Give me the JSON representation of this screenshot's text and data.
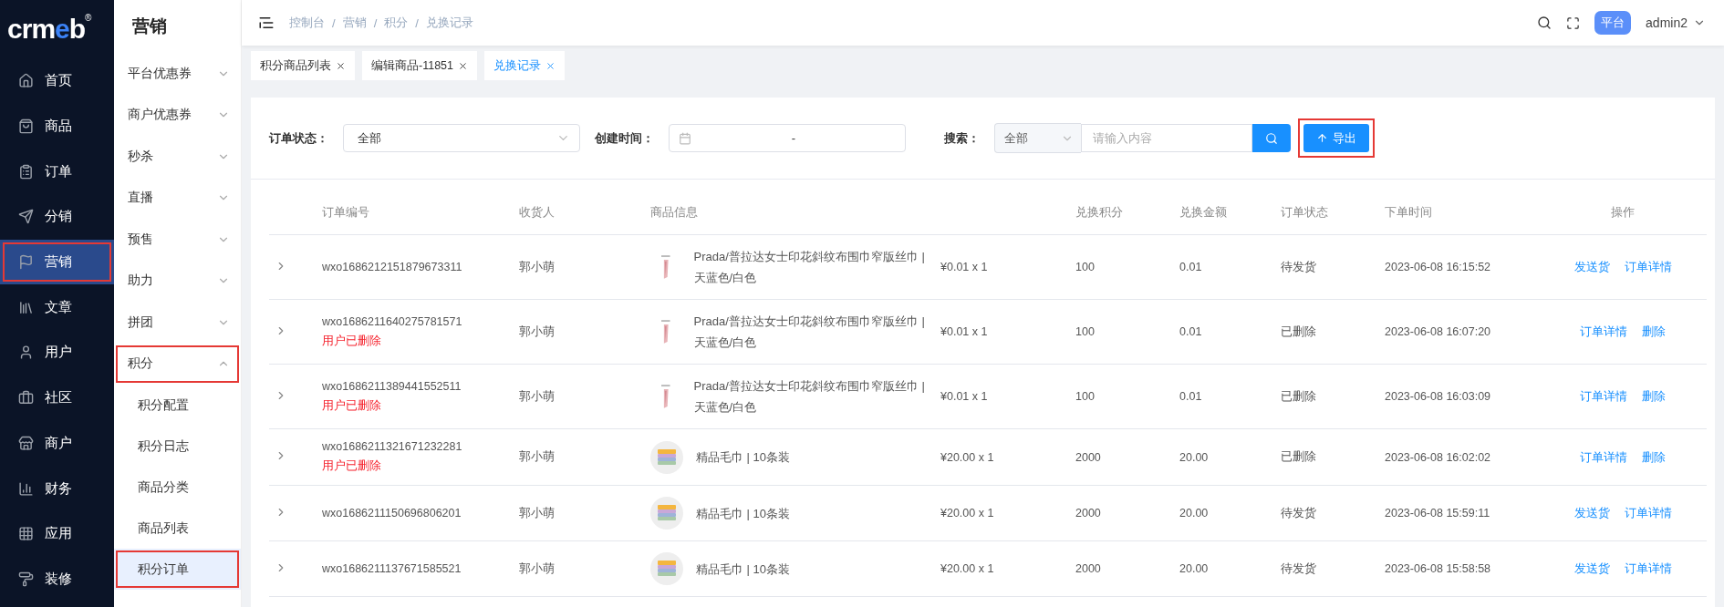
{
  "logo": {
    "text": "crmeb",
    "registered": "®"
  },
  "main_nav": {
    "items": [
      {
        "label": "首页",
        "selected": false,
        "highlighted": false
      },
      {
        "label": "商品",
        "selected": false,
        "highlighted": false
      },
      {
        "label": "订单",
        "selected": false,
        "highlighted": false
      },
      {
        "label": "分销",
        "selected": false,
        "highlighted": false
      },
      {
        "label": "营销",
        "selected": true,
        "highlighted": true
      },
      {
        "label": "文章",
        "selected": false,
        "highlighted": false
      },
      {
        "label": "用户",
        "selected": false,
        "highlighted": false
      },
      {
        "label": "社区",
        "selected": false,
        "highlighted": false
      },
      {
        "label": "商户",
        "selected": false,
        "highlighted": false
      },
      {
        "label": "财务",
        "selected": false,
        "highlighted": false
      },
      {
        "label": "应用",
        "selected": false,
        "highlighted": false
      },
      {
        "label": "装修",
        "selected": false,
        "highlighted": false
      }
    ]
  },
  "sub_nav": {
    "title": "营销",
    "items": [
      {
        "label": "平台优惠券",
        "expanded": false,
        "highlighted": false
      },
      {
        "label": "商户优惠券",
        "expanded": false,
        "highlighted": false
      },
      {
        "label": "秒杀",
        "expanded": false,
        "highlighted": false
      },
      {
        "label": "直播",
        "expanded": false,
        "highlighted": false
      },
      {
        "label": "预售",
        "expanded": false,
        "highlighted": false
      },
      {
        "label": "助力",
        "expanded": false,
        "highlighted": false
      },
      {
        "label": "拼团",
        "expanded": false,
        "highlighted": false
      },
      {
        "label": "积分",
        "expanded": true,
        "highlighted": true,
        "children": [
          {
            "label": "积分配置",
            "selected": false,
            "highlighted": false
          },
          {
            "label": "积分日志",
            "selected": false,
            "highlighted": false
          },
          {
            "label": "商品分类",
            "selected": false,
            "highlighted": false
          },
          {
            "label": "商品列表",
            "selected": false,
            "highlighted": false
          },
          {
            "label": "积分订单",
            "selected": true,
            "highlighted": true
          }
        ]
      }
    ]
  },
  "breadcrumb": {
    "separator": "/",
    "items": [
      "控制台",
      "营销",
      "积分",
      "兑换记录"
    ]
  },
  "header": {
    "badge": "平台",
    "user": "admin2"
  },
  "tabs": [
    {
      "label": "积分商品列表",
      "selected": false
    },
    {
      "label": "编辑商品-11851",
      "selected": false
    },
    {
      "label": "兑换记录",
      "selected": true
    }
  ],
  "filters": {
    "status": {
      "label": "订单状态：",
      "value": "全部"
    },
    "created": {
      "label": "创建时间：",
      "separator": "-"
    },
    "search": {
      "label": "搜索：",
      "scope": "全部",
      "placeholder": "请输入内容"
    },
    "export": {
      "label": "导出",
      "highlighted": true
    }
  },
  "table": {
    "columns": [
      "订单编号",
      "收货人",
      "商品信息",
      "兑换积分",
      "兑换金额",
      "订单状态",
      "下单时间",
      "操作"
    ],
    "rows": [
      {
        "order_no": "wxo1686212151879673311",
        "receiver": "郭小萌",
        "product": "Prada/普拉达女士印花斜纹布围巾窄版丝巾 | 天蓝色/白色",
        "price": "¥0.01 x 1",
        "points": "100",
        "amount": "0.01",
        "status": "待发货",
        "time": "2023-06-08 16:15:52",
        "actions": [
          "发送货",
          "订单详情"
        ]
      },
      {
        "order_no": "wxo1686211640275781571",
        "note": "用户已删除",
        "receiver": "郭小萌",
        "product": "Prada/普拉达女士印花斜纹布围巾窄版丝巾 | 天蓝色/白色",
        "price": "¥0.01 x 1",
        "points": "100",
        "amount": "0.01",
        "status": "已删除",
        "time": "2023-06-08 16:07:20",
        "actions": [
          "订单详情",
          "删除"
        ]
      },
      {
        "order_no": "wxo1686211389441552511",
        "note": "用户已删除",
        "receiver": "郭小萌",
        "product": "Prada/普拉达女士印花斜纹布围巾窄版丝巾 | 天蓝色/白色",
        "price": "¥0.01 x 1",
        "points": "100",
        "amount": "0.01",
        "status": "已删除",
        "time": "2023-06-08 16:03:09",
        "actions": [
          "订单详情",
          "删除"
        ]
      },
      {
        "order_no": "wxo1686211321671232281",
        "note": "用户已删除",
        "receiver": "郭小萌",
        "product": "精品毛巾 | 10条装",
        "price": "¥20.00 x 1",
        "points": "2000",
        "amount": "20.00",
        "status": "已删除",
        "time": "2023-06-08 16:02:02",
        "actions": [
          "订单详情",
          "删除"
        ]
      },
      {
        "order_no": "wxo1686211150696806201",
        "receiver": "郭小萌",
        "product": "精品毛巾 | 10条装",
        "price": "¥20.00 x 1",
        "points": "2000",
        "amount": "20.00",
        "status": "待发货",
        "time": "2023-06-08 15:59:11",
        "actions": [
          "发送货",
          "订单详情"
        ]
      },
      {
        "order_no": "wxo1686211137671585521",
        "receiver": "郭小萌",
        "product": "精品毛巾 | 10条装",
        "price": "¥20.00 x 1",
        "points": "2000",
        "amount": "20.00",
        "status": "待发货",
        "time": "2023-06-08 15:58:58",
        "actions": [
          "发送货",
          "订单详情"
        ]
      }
    ]
  }
}
